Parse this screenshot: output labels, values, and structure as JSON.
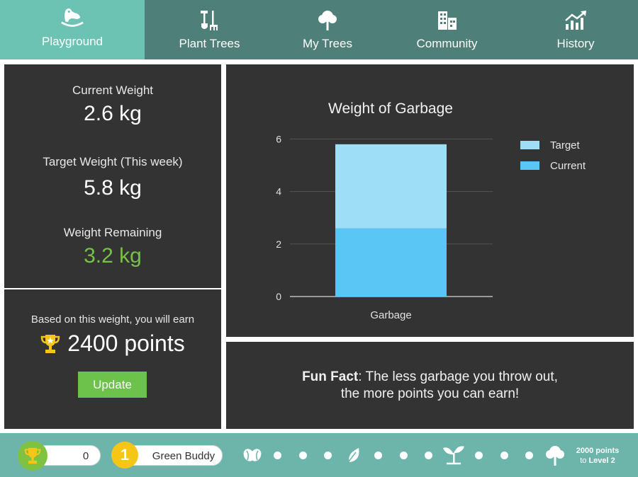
{
  "nav": {
    "tabs": [
      {
        "label": "Playground",
        "icon": "rocking-horse-icon",
        "active": true
      },
      {
        "label": "Plant Trees",
        "icon": "garden-tools-icon"
      },
      {
        "label": "My Trees",
        "icon": "tree-icon"
      },
      {
        "label": "Community",
        "icon": "buildings-icon"
      },
      {
        "label": "History",
        "icon": "chart-up-icon"
      }
    ]
  },
  "stats": {
    "current_label": "Current Weight",
    "current_value": "2.6 kg",
    "target_label": "Target Weight (This week)",
    "target_value": "5.8 kg",
    "remaining_label": "Weight Remaining",
    "remaining_value": "3.2 kg"
  },
  "earn": {
    "label": "Based on this weight, you will earn",
    "points": "2400 points",
    "button": "Update"
  },
  "chart_data": {
    "type": "bar",
    "title": "Weight of Garbage",
    "categories": [
      "Garbage"
    ],
    "series": [
      {
        "name": "Target",
        "values": [
          5.8
        ],
        "color": "#9edff7"
      },
      {
        "name": "Current",
        "values": [
          2.6
        ],
        "color": "#5ac6f6"
      }
    ],
    "ylim": [
      0,
      6.2
    ],
    "yticks": [
      "0",
      "2",
      "4",
      "6"
    ],
    "legend": "top-right",
    "grid": true
  },
  "fact": {
    "bold": "Fun Fact",
    "line1": ": The less garbage you throw out,",
    "line2": "the more points you can earn!"
  },
  "bottom": {
    "score": "0",
    "level_number": "1",
    "level_name": "Green Buddy",
    "next_points": "2000 points",
    "next_to": "to ",
    "next_level": "Level 2"
  },
  "colors": {
    "nav": "#4e7f78",
    "nav_active": "#6cc2b3",
    "panel": "#333333",
    "accent_green": "#78c148",
    "bottom_bar": "#6db5aa"
  }
}
